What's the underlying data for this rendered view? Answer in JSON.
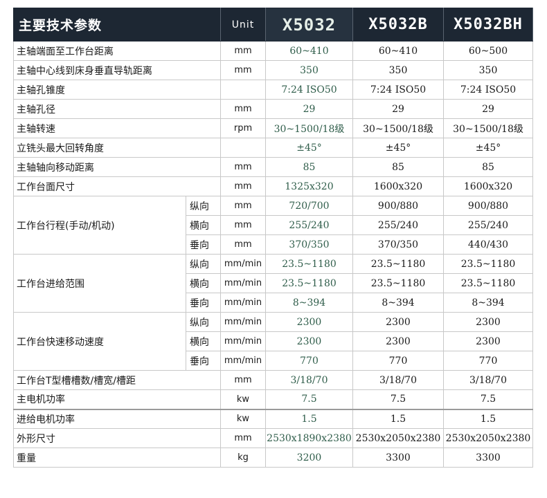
{
  "header": {
    "title": "主要技术参数",
    "unit": "Unit",
    "models": [
      "X5032",
      "X5032B",
      "X5032BH"
    ]
  },
  "rows": [
    {
      "name": "主轴端面至工作台距离",
      "unit": "mm",
      "values": [
        "60~410",
        "60~410",
        "60~500"
      ]
    },
    {
      "name": "主轴中心线到床身垂直导轨距离",
      "unit": "mm",
      "values": [
        "350",
        "350",
        "350"
      ]
    },
    {
      "name": "主轴孔锥度",
      "unit": "",
      "values": [
        "7:24 ISO50",
        "7:24 ISO50",
        "7:24 ISO50"
      ]
    },
    {
      "name": "主轴孔径",
      "unit": "mm",
      "values": [
        "29",
        "29",
        "29"
      ]
    },
    {
      "name": "主轴转速",
      "unit": "rpm",
      "values": [
        "30~1500/18级",
        "30~1500/18级",
        "30~1500/18级"
      ]
    },
    {
      "name": "立铣头最大回转角度",
      "unit": "",
      "values": [
        "±45°",
        "±45°",
        "±45°"
      ]
    },
    {
      "name": "主轴轴向移动距离",
      "unit": "mm",
      "values": [
        "85",
        "85",
        "85"
      ]
    },
    {
      "name": "工作台面尺寸",
      "unit": "mm",
      "values": [
        "1325x320",
        "1600x320",
        "1600x320"
      ]
    }
  ],
  "groups": [
    {
      "name": "工作台行程(手动/机动)",
      "rows": [
        {
          "sub": "纵向",
          "unit": "mm",
          "values": [
            "720/700",
            "900/880",
            "900/880"
          ]
        },
        {
          "sub": "横向",
          "unit": "mm",
          "values": [
            "255/240",
            "255/240",
            "255/240"
          ]
        },
        {
          "sub": "垂向",
          "unit": "mm",
          "values": [
            "370/350",
            "370/350",
            "440/430"
          ]
        }
      ]
    },
    {
      "name": "工作台进给范围",
      "rows": [
        {
          "sub": "纵向",
          "unit": "mm/min",
          "values": [
            "23.5~1180",
            "23.5~1180",
            "23.5~1180"
          ]
        },
        {
          "sub": "横向",
          "unit": "mm/min",
          "values": [
            "23.5~1180",
            "23.5~1180",
            "23.5~1180"
          ]
        },
        {
          "sub": "垂向",
          "unit": "mm/min",
          "values": [
            "8~394",
            "8~394",
            "8~394"
          ]
        }
      ]
    },
    {
      "name": "工作台快速移动速度",
      "rows": [
        {
          "sub": "纵向",
          "unit": "mm/min",
          "values": [
            "2300",
            "2300",
            "2300"
          ]
        },
        {
          "sub": "横向",
          "unit": "mm/min",
          "values": [
            "2300",
            "2300",
            "2300"
          ]
        },
        {
          "sub": "垂向",
          "unit": "mm/min",
          "values": [
            "770",
            "770",
            "770"
          ]
        }
      ]
    }
  ],
  "tail_rows": [
    {
      "name": "工作台T型槽槽数/槽宽/槽距",
      "unit": "mm",
      "values": [
        "3/18/70",
        "3/18/70",
        "3/18/70"
      ]
    },
    {
      "name": "主电机功率",
      "unit": "kw",
      "values": [
        "7.5",
        "7.5",
        "7.5"
      ]
    },
    {
      "name": "进给电机功率",
      "unit": "kw",
      "values": [
        "1.5",
        "1.5",
        "1.5"
      ]
    },
    {
      "name": "外形尺寸",
      "unit": "mm",
      "values": [
        "2530x1890x2380",
        "2530x2050x2380",
        "2530x2050x2380"
      ]
    },
    {
      "name": "重量",
      "unit": "kg",
      "values": [
        "3200",
        "3300",
        "3300"
      ]
    }
  ],
  "colors": {
    "header_bg": "#1d2733",
    "first_model_text": "#2f5d4a"
  }
}
